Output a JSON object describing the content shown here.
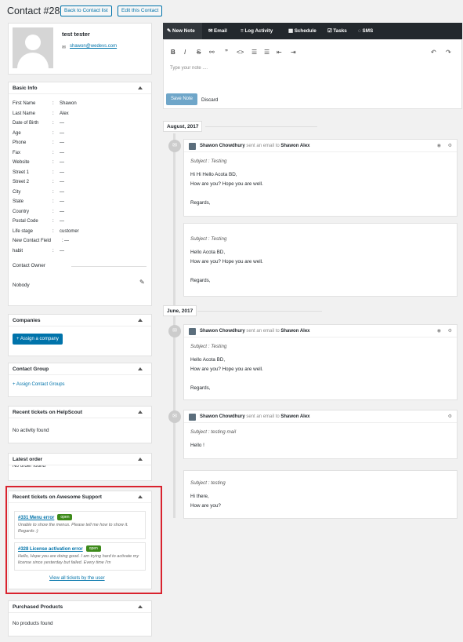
{
  "header": {
    "title": "Contact #28",
    "back_label": "Back to Contact list",
    "edit_label": "Edit this Contact"
  },
  "profile": {
    "name": "test tester",
    "email": "shawon@wedevs.com",
    "email_icon": "envelope-icon"
  },
  "basic_info": {
    "title": "Basic Info",
    "rows": [
      {
        "label": "First Name",
        "value": "Shawon"
      },
      {
        "label": "Last Name",
        "value": "Alex"
      },
      {
        "label": "Date of Birth",
        "value": "—"
      },
      {
        "label": "Age",
        "value": "—"
      },
      {
        "label": "Phone",
        "value": "—"
      },
      {
        "label": "Fax",
        "value": "—"
      },
      {
        "label": "Website",
        "value": "—"
      },
      {
        "label": "Street 1",
        "value": "—"
      },
      {
        "label": "Street 2",
        "value": "—"
      },
      {
        "label": "City",
        "value": "—"
      },
      {
        "label": "State",
        "value": "—"
      },
      {
        "label": "Country",
        "value": "—"
      },
      {
        "label": "Postal Code",
        "value": "—"
      },
      {
        "label": "Life stage",
        "value": "customer"
      },
      {
        "label": "New Contact Field",
        "value": "—"
      },
      {
        "label": "habit",
        "value": "—"
      }
    ],
    "owner_label": "Contact Owner",
    "owner_value": "Nobody"
  },
  "companies": {
    "title": "Companies",
    "button": "+ Assign a company"
  },
  "contact_group": {
    "title": "Contact Group",
    "link": "+ Assign Contact Groups"
  },
  "helpscout": {
    "title": "Recent tickets on HelpScout",
    "empty": "No activity found"
  },
  "latest_order": {
    "title": "Latest order",
    "empty": "No order found"
  },
  "awesome_support": {
    "title": "Recent tickets on Awesome Support",
    "tickets": [
      {
        "title": "#331 Menu error",
        "status": "open",
        "desc": "Unable to show the menus. Please tell me how to show it. Regards :)"
      },
      {
        "title": "#328 License activation error",
        "status": "open",
        "desc": "Hello, Hope you are doing good. I am trying hard to activate my license since yesterday but failed. Every time I'm"
      }
    ],
    "view_all": "View all tickets by the user"
  },
  "purchased": {
    "title": "Purchased Products",
    "empty": "No products found"
  },
  "toolbar": {
    "tabs": [
      "New Note",
      "Email",
      "Log Activity",
      "Schedule",
      "Tasks",
      "SMS"
    ]
  },
  "editor": {
    "placeholder": "Type your note ....",
    "save": "Save Note",
    "discard": "Discard"
  },
  "timeline": {
    "date1": "August, 2017",
    "date2": "June, 2017",
    "sent_text": "sent an email to",
    "sender": "Shawon Chowdhury",
    "recipient": "Shawon Alex",
    "items": [
      {
        "subject": "Subject : Testing",
        "lines": [
          "Hi Hi Hello Acota BD,",
          "How are you? Hope you are well.",
          "",
          "Regards,"
        ]
      },
      {
        "subject": "Subject : Testing",
        "lines": [
          "Hello Acota BD,",
          "How are you? Hope you are well.",
          "",
          "Regards,"
        ]
      },
      {
        "subject": "Subject : Testing",
        "lines": [
          "Hello Acota BD,",
          "How are you? Hope you are well.",
          "",
          "Regards,"
        ]
      },
      {
        "subject": "Subject : testing mail",
        "lines": [
          "Hello !"
        ]
      },
      {
        "subject": "Subject : testing",
        "lines": [
          "Hi there,",
          "How are you?"
        ]
      }
    ]
  },
  "colors": {
    "accent": "#0073aa",
    "highlight": "#d9232e",
    "dark": "#23282d"
  }
}
